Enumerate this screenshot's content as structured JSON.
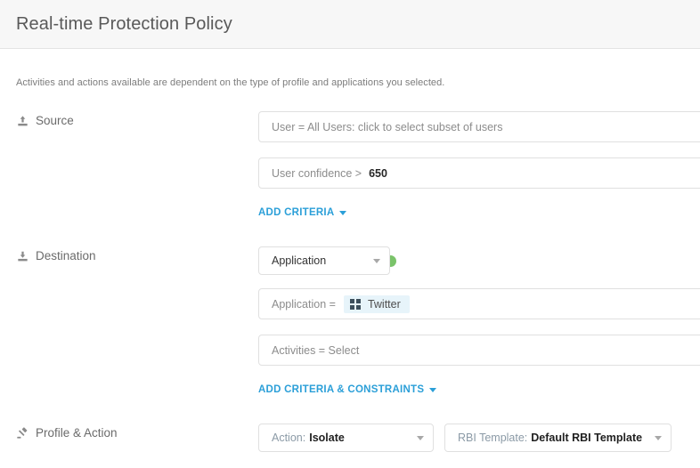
{
  "header": {
    "title": "Real-time Protection Policy"
  },
  "hint": {
    "text": "Activities and actions available are dependent on the type of profile and applications you selected."
  },
  "colors": {
    "accent_link": "#2b9fd8",
    "header_bg": "#f7f7f7",
    "status_green": "#7ac36a",
    "chip_bg": "#e7f4fa",
    "chip_icon": "#3d4f5c",
    "border": "#e0e0e0"
  },
  "sections": [
    {
      "id": "source",
      "label": "Source",
      "icon": "upload-icon",
      "criteria": [
        {
          "id": "user",
          "text": "User = All Users: click to select subset of users",
          "value": ""
        },
        {
          "id": "user-confidence",
          "text": "User confidence >",
          "value": "650"
        }
      ],
      "add_link": {
        "label": "ADD CRITERIA",
        "caret": "chevron-down-icon"
      }
    },
    {
      "id": "destination",
      "label": "Destination",
      "icon": "download-icon",
      "select": {
        "label": "Application",
        "caret": "chevron-down-icon",
        "status": "green-status-dot"
      },
      "criteria": [
        {
          "id": "application",
          "text": "Application =",
          "chip": {
            "label": "Twitter",
            "icon": "grid-apps-icon"
          }
        },
        {
          "id": "activities",
          "text": "Activities = Select",
          "value": ""
        }
      ],
      "add_link": {
        "label": "ADD CRITERIA & CONSTRAINTS",
        "caret": "chevron-down-icon"
      }
    },
    {
      "id": "profile-action",
      "label": "Profile & Action",
      "icon": "gavel-icon",
      "dropdowns": [
        {
          "id": "action",
          "prefix": "Action:",
          "value": "Isolate",
          "caret": "chevron-down-icon"
        },
        {
          "id": "rbi-template",
          "prefix": "RBI Template:",
          "value": "Default RBI Template",
          "caret": "chevron-down-icon"
        }
      ]
    }
  ]
}
